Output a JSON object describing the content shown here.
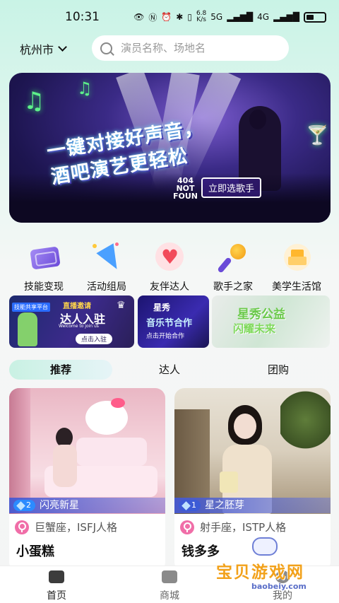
{
  "status_bar": {
    "time": "10:31",
    "net_speed_top": "6.8",
    "net_speed_bottom": "K/s",
    "signal1": "5G",
    "signal2": "4G"
  },
  "header": {
    "city": "杭州市",
    "search_placeholder": "演员名称、场地名"
  },
  "banner": {
    "headline_line1": "一键对接好声音，",
    "headline_line2": "酒吧演艺更轻松",
    "cta": "立即选歌手",
    "error_code": "404",
    "error_text1": "NOT",
    "error_text2": "FOUN"
  },
  "menu": [
    {
      "label": "技能变现",
      "icon": "wallet-icon"
    },
    {
      "label": "活动组局",
      "icon": "party-popper-icon"
    },
    {
      "label": "友伴达人",
      "icon": "heart-icon"
    },
    {
      "label": "歌手之家",
      "icon": "microphone-icon"
    },
    {
      "label": "美学生活馆",
      "icon": "building-icon"
    }
  ],
  "promos": [
    {
      "tag": "技能共享平台",
      "title1": "直播邀请",
      "title2": "达人入驻",
      "small": "Welcome to join us",
      "button": "点击入驻"
    },
    {
      "tag": "星秀",
      "title1": "音乐节合作",
      "button": "点击开始合作"
    },
    {
      "title1": "星秀公益",
      "title2": "闪耀未来"
    }
  ],
  "tabs": [
    {
      "label": "推荐",
      "active": true
    },
    {
      "label": "达人",
      "active": false
    },
    {
      "label": "团购",
      "active": false
    }
  ],
  "cards": [
    {
      "rank_num": "2",
      "rank_label": "闪亮新星",
      "zodiac": "巨蟹座，ISFJ人格",
      "name": "小蛋糕"
    },
    {
      "rank_num": "1",
      "rank_label": "星之胚芽",
      "zodiac": "射手座，ISTP人格",
      "name": "钱多多"
    }
  ],
  "bottom_nav": [
    {
      "label": "首页",
      "active": true
    },
    {
      "label": "商城",
      "active": false
    },
    {
      "label": "我的",
      "active": false
    }
  ],
  "watermark": {
    "text": "宝贝游戏网",
    "url": "baobeiy.com"
  },
  "colors": {
    "accent": "#2dbf8f",
    "rank_blue": "#4a63d6",
    "female_pink": "#f06ea8",
    "watermark_orange": "#f2a11a"
  }
}
